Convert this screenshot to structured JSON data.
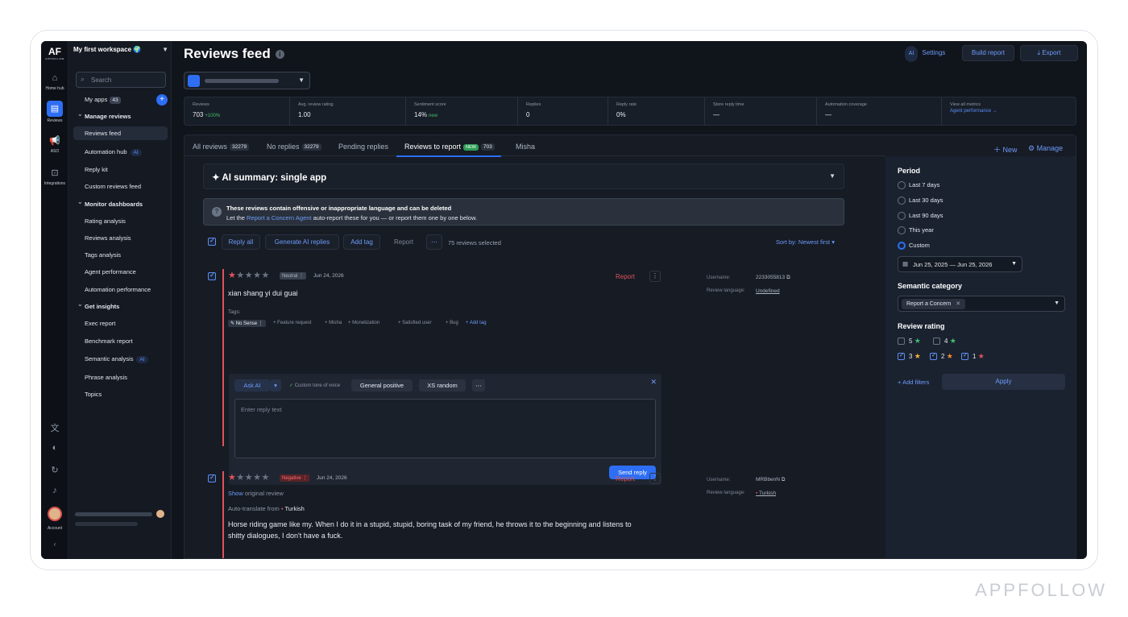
{
  "rail": {
    "logo": "AF",
    "logo_sub": "APPFOLLOW",
    "items": [
      {
        "label": "Home hub",
        "icon": "home-icon"
      },
      {
        "label": "Reviews",
        "icon": "chat-icon"
      },
      {
        "label": "ASO",
        "icon": "megaphone-icon"
      },
      {
        "label": "Integrations",
        "icon": "integrations-icon"
      }
    ],
    "account_label": "Account"
  },
  "sidebar": {
    "workspace": "My first workspace",
    "search_placeholder": "Search",
    "my_apps": "My apps",
    "my_apps_count": "43",
    "items": [
      {
        "label": "Manage reviews",
        "group": true
      },
      {
        "label": "Reviews feed",
        "selected": true
      },
      {
        "label": "Automation hub",
        "ai": "AI"
      },
      {
        "label": "Reply kit"
      },
      {
        "label": "Custom reviews feed"
      },
      {
        "label": "Monitor dashboards",
        "group": true
      },
      {
        "label": "Rating analysis"
      },
      {
        "label": "Reviews analysis"
      },
      {
        "label": "Tags analysis"
      },
      {
        "label": "Agent performance"
      },
      {
        "label": "Automation performance"
      },
      {
        "label": "Get insights",
        "group": true
      },
      {
        "label": "Exec report"
      },
      {
        "label": "Benchmark report"
      },
      {
        "label": "Semantic analysis",
        "ai": "AI"
      },
      {
        "label": "Phrase analysis"
      },
      {
        "label": "Topics"
      }
    ]
  },
  "header": {
    "title": "Reviews feed",
    "ai_badge": "AI",
    "settings": "Settings",
    "build_report": "Build report",
    "export": "Export"
  },
  "metrics": [
    {
      "label": "Reviews",
      "value": "703",
      "delta": "+100%"
    },
    {
      "label": "Avg. review rating",
      "value": "1.00"
    },
    {
      "label": "Sentiment score",
      "value": "14%",
      "delta": "new"
    },
    {
      "label": "Replies",
      "value": "0"
    },
    {
      "label": "Reply rate",
      "value": "0%"
    },
    {
      "label": "Store reply time",
      "value": "—"
    },
    {
      "label": "Automation coverage",
      "value": "—"
    },
    {
      "label": "View all metrics",
      "link": "Agent performance →"
    }
  ],
  "tabs": [
    {
      "label": "All reviews",
      "count": "32279"
    },
    {
      "label": "No replies",
      "count": "32279"
    },
    {
      "label": "Pending replies"
    },
    {
      "label": "Reviews to report",
      "badge": "NEW",
      "count": "703",
      "active": true
    },
    {
      "label": "Misha"
    }
  ],
  "tab_actions": {
    "new": "New",
    "manage": "Manage"
  },
  "summary": {
    "title": "AI summary: single app"
  },
  "warning": {
    "line1": "These reviews contain offensive or inappropriate language and can be deleted",
    "line2_pre": "Let the",
    "line2_link": "Report a Concern Agent",
    "line2_post": "auto-report these for you — or report them one by one below."
  },
  "toolbar": {
    "reply_all": "Reply all",
    "generate": "Generate AI replies",
    "add_tag": "Add tag",
    "report": "Report",
    "more": "⋯",
    "selected": "75 reviews selected",
    "sort": "Sort by: Newest first"
  },
  "reviews": [
    {
      "rating": 1,
      "sentiment": "Neutral",
      "date": "Jun 24, 2026",
      "report": "Report",
      "text": "xian shang yi dui guai",
      "tags_label": "Tags:",
      "tags": [
        "No Sense",
        "Feature request",
        "Misha",
        "Monetization",
        "Satisfied user",
        "Bug"
      ],
      "add_tag": "Add tag",
      "username_label": "Username:",
      "username": "2233055813",
      "lang_label": "Review language:",
      "lang": "Undefined"
    },
    {
      "rating": 1,
      "sentiment": "Negative",
      "date": "Jun 24, 2026",
      "report": "Report",
      "show": "Show",
      "show_rest": "original review",
      "translate_label": "Auto-translate from",
      "translate_lang": "Turkish",
      "text1": "Horse riding game like my. When I do it in a stupid, stupid, boring task of my friend, he throws it to the beginning and listens to",
      "text2": "shitty dialogues, I don't have a fuck.",
      "username_label": "Username:",
      "username": "MRBbenN",
      "lang_label": "Review language:",
      "lang": "Turkish"
    }
  ],
  "reply": {
    "ask_ai": "Ask AI",
    "custom_tone": "Custom tone of voice",
    "template1": "General positive",
    "template2": "XS random",
    "placeholder": "Enter reply text",
    "send": "Send reply"
  },
  "filters": {
    "period_title": "Period",
    "periods": [
      "Last 7 days",
      "Last 30 days",
      "Last 90 days",
      "This year",
      "Custom"
    ],
    "selected_period": "Custom",
    "date_range": "Jun 25, 2025 — Jun 25, 2026",
    "semantic_title": "Semantic category",
    "semantic_chip": "Report a Concern",
    "rating_title": "Review rating",
    "ratings": [
      {
        "value": "5",
        "checked": false
      },
      {
        "value": "4",
        "checked": false
      },
      {
        "value": "3",
        "checked": true
      },
      {
        "value": "2",
        "checked": true
      },
      {
        "value": "1",
        "checked": true
      }
    ],
    "add_filters": "Add filters",
    "apply": "Apply"
  },
  "watermark": "APPFOLLOW",
  "colors": {
    "accent": "#2d6ef5",
    "danger": "#e0525a",
    "success": "#3fbf6e",
    "bg": "#10141b"
  }
}
